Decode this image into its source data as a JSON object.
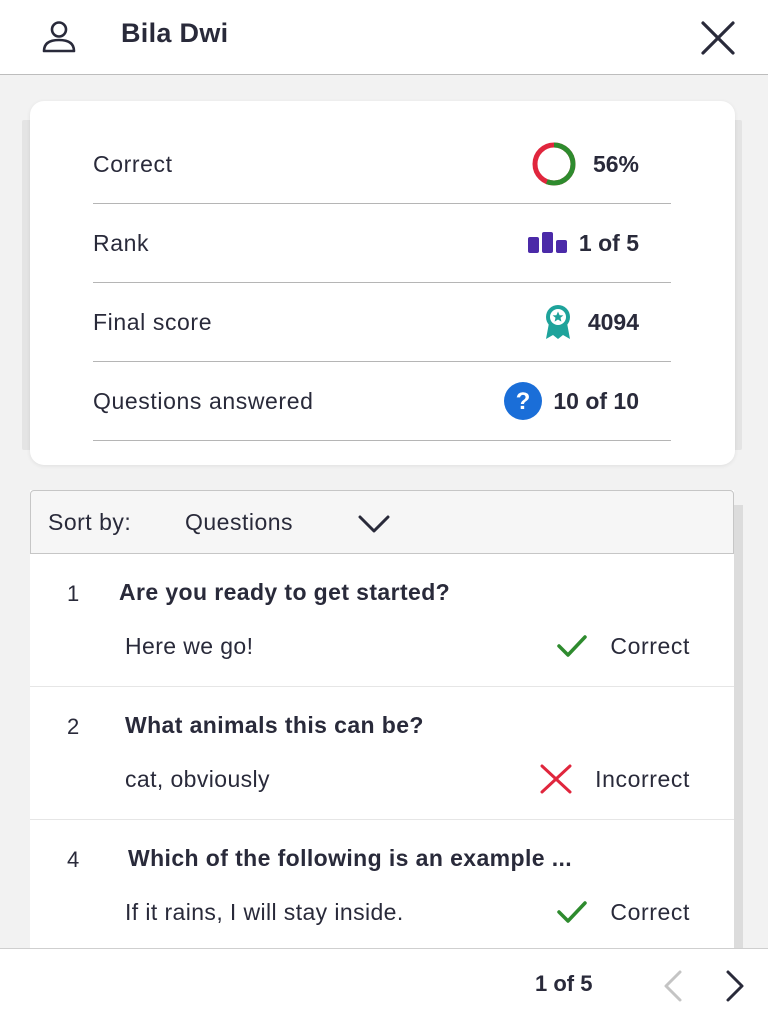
{
  "header": {
    "user_name": "Bila Dwi"
  },
  "stats": [
    {
      "label": "Correct",
      "value": "56%",
      "icon": "accuracy-ring-icon",
      "percent": 56
    },
    {
      "label": "Rank",
      "value": "1 of 5",
      "icon": "podium-icon"
    },
    {
      "label": "Final score",
      "value": "4094",
      "icon": "award-ribbon-icon"
    },
    {
      "label": "Questions answered",
      "value": "10 of 10",
      "icon": "question-circle-icon"
    }
  ],
  "sort": {
    "label": "Sort by:",
    "value": "Questions"
  },
  "questions": [
    {
      "number": "1",
      "text": "Are you ready to get started?",
      "answer": "Here we go!",
      "status": "Correct"
    },
    {
      "number": "2",
      "text": "What animals this can be?",
      "answer": "cat, obviously",
      "status": "Incorrect"
    },
    {
      "number": "4",
      "text": "Which of the following is an example ...",
      "answer": "If it rains, I will stay inside.",
      "status": "Correct"
    }
  ],
  "pagination": {
    "text": "1 of 5"
  },
  "colors": {
    "correct": "#2e8b2e",
    "incorrect": "#e0263d",
    "rank": "#4b2aa8",
    "score": "#1ea39b",
    "question": "#1a6ed8",
    "text": "#292a3a"
  }
}
